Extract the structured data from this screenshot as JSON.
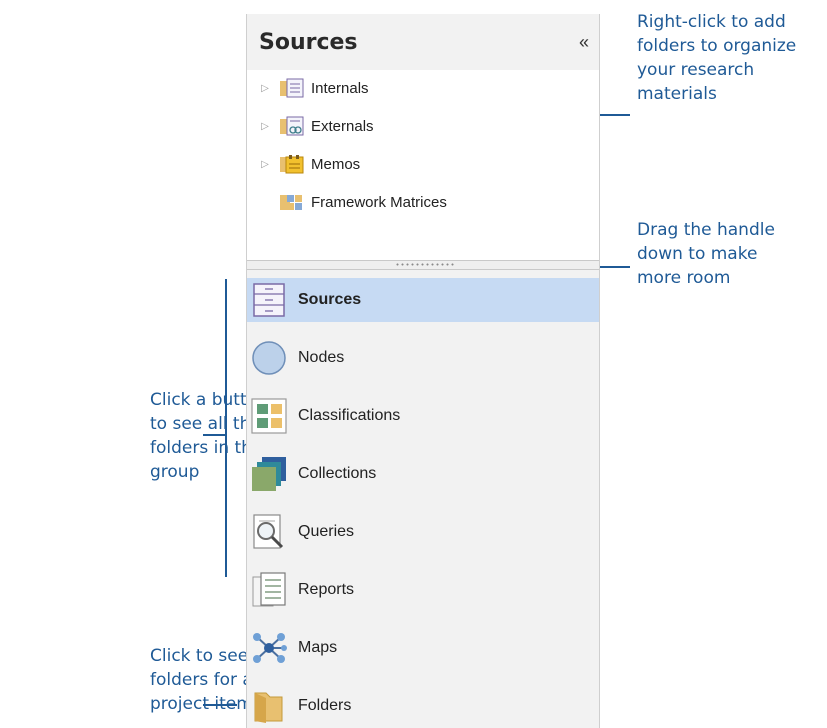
{
  "panel": {
    "title": "Sources",
    "collapse_glyph": "«"
  },
  "tree": [
    {
      "label": "Internals",
      "expandable": true,
      "icon": "internals-folder-icon"
    },
    {
      "label": "Externals",
      "expandable": true,
      "icon": "externals-folder-icon"
    },
    {
      "label": "Memos",
      "expandable": true,
      "icon": "memos-folder-icon"
    },
    {
      "label": "Framework Matrices",
      "expandable": false,
      "icon": "framework-matrices-folder-icon"
    }
  ],
  "expander_glyph": "▷",
  "nav": [
    {
      "label": "Sources",
      "active": true,
      "icon": "sources-icon"
    },
    {
      "label": "Nodes",
      "active": false,
      "icon": "nodes-icon"
    },
    {
      "label": "Classifications",
      "active": false,
      "icon": "classifications-icon"
    },
    {
      "label": "Collections",
      "active": false,
      "icon": "collections-icon"
    },
    {
      "label": "Queries",
      "active": false,
      "icon": "queries-icon"
    },
    {
      "label": "Reports",
      "active": false,
      "icon": "reports-icon"
    },
    {
      "label": "Maps",
      "active": false,
      "icon": "maps-icon"
    },
    {
      "label": "Folders",
      "active": false,
      "icon": "folders-icon"
    }
  ],
  "annotations": {
    "right_click": "Right-click to add\nfolders to organize\nyour research\nmaterials",
    "drag_handle": "Drag the handle\ndown to make\nmore room",
    "click_button": "Click a button\nto see all the\nfolders in the\ngroup",
    "click_folders": "Click to see\nfolders for all\nproject items"
  },
  "colors": {
    "annotation": "#1f5a96",
    "active_nav": "#c6daf3",
    "header_bg": "#f2f2f2"
  }
}
